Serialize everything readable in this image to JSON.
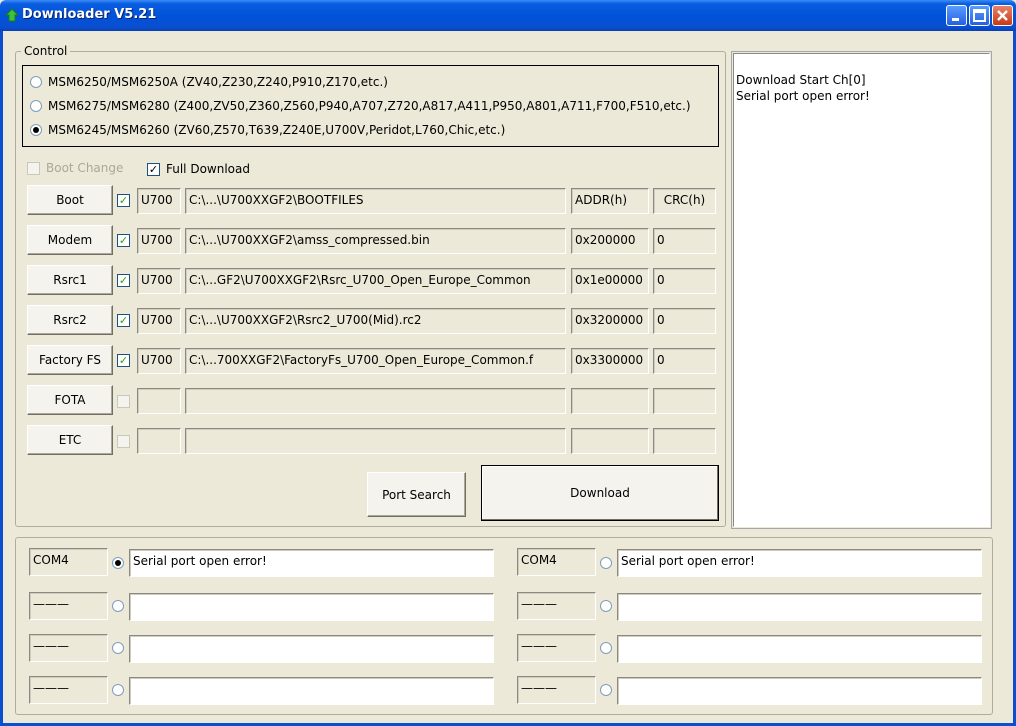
{
  "window": {
    "title": "Downloader V5.21"
  },
  "control": {
    "legend": "Control",
    "models": [
      {
        "label": "MSM6250/MSM6250A (ZV40,Z230,Z240,P910,Z170,etc.)",
        "selected": false
      },
      {
        "label": "MSM6275/MSM6280 (Z400,ZV50,Z360,Z560,P940,A707,Z720,A817,A411,P950,A801,A711,F700,F510,etc.)",
        "selected": false
      },
      {
        "label": "MSM6245/MSM6260 (ZV60,Z570,T639,Z240E,U700V,Peridot,L760,Chic,etc.)",
        "selected": true
      }
    ],
    "boot_change": "Boot Change",
    "full_download": "Full Download",
    "header_addr": "ADDR(h)",
    "header_crc": "CRC(h)",
    "rows": [
      {
        "button": "Boot",
        "checked": true,
        "model": "U700",
        "path": "C:\\...\\U700XXGF2\\BOOTFILES",
        "addr": "ADDR(h)",
        "crc": "CRC(h)"
      },
      {
        "button": "Modem",
        "checked": true,
        "model": "U700",
        "path": "C:\\...\\U700XXGF2\\amss_compressed.bin",
        "addr": "0x200000",
        "crc": "0"
      },
      {
        "button": "Rsrc1",
        "checked": true,
        "model": "U700",
        "path": "C:\\...GF2\\U700XXGF2\\Rsrc_U700_Open_Europe_Common",
        "addr": "0x1e00000",
        "crc": "0"
      },
      {
        "button": "Rsrc2",
        "checked": true,
        "model": "U700",
        "path": "C:\\...\\U700XXGF2\\Rsrc2_U700(Mid).rc2",
        "addr": "0x3200000",
        "crc": "0"
      },
      {
        "button": "Factory FS",
        "checked": true,
        "model": "U700",
        "path": "C:\\...700XXGF2\\FactoryFs_U700_Open_Europe_Common.f",
        "addr": "0x3300000",
        "crc": "0"
      },
      {
        "button": "FOTA",
        "checked": false,
        "model": "",
        "path": "",
        "addr": "",
        "crc": ""
      },
      {
        "button": "ETC",
        "checked": false,
        "model": "",
        "path": "",
        "addr": "",
        "crc": ""
      }
    ],
    "port_search": "Port Search",
    "download": "Download"
  },
  "log": {
    "lines": [
      "Download Start Ch[0]",
      "Serial port open error!"
    ]
  },
  "ports": {
    "left": [
      {
        "port": "COM4",
        "selected": true,
        "status": "Serial port open error!"
      },
      {
        "port": "———",
        "selected": false,
        "status": ""
      },
      {
        "port": "———",
        "selected": false,
        "status": ""
      },
      {
        "port": "———",
        "selected": false,
        "status": ""
      }
    ],
    "right": [
      {
        "port": "COM4",
        "selected": false,
        "status": "Serial port open error!"
      },
      {
        "port": "———",
        "selected": false,
        "status": ""
      },
      {
        "port": "———",
        "selected": false,
        "status": ""
      },
      {
        "port": "———",
        "selected": false,
        "status": ""
      }
    ]
  },
  "colors": {
    "titlebar": "#0052d9",
    "face": "#ece9d8",
    "check": "#21a121"
  }
}
